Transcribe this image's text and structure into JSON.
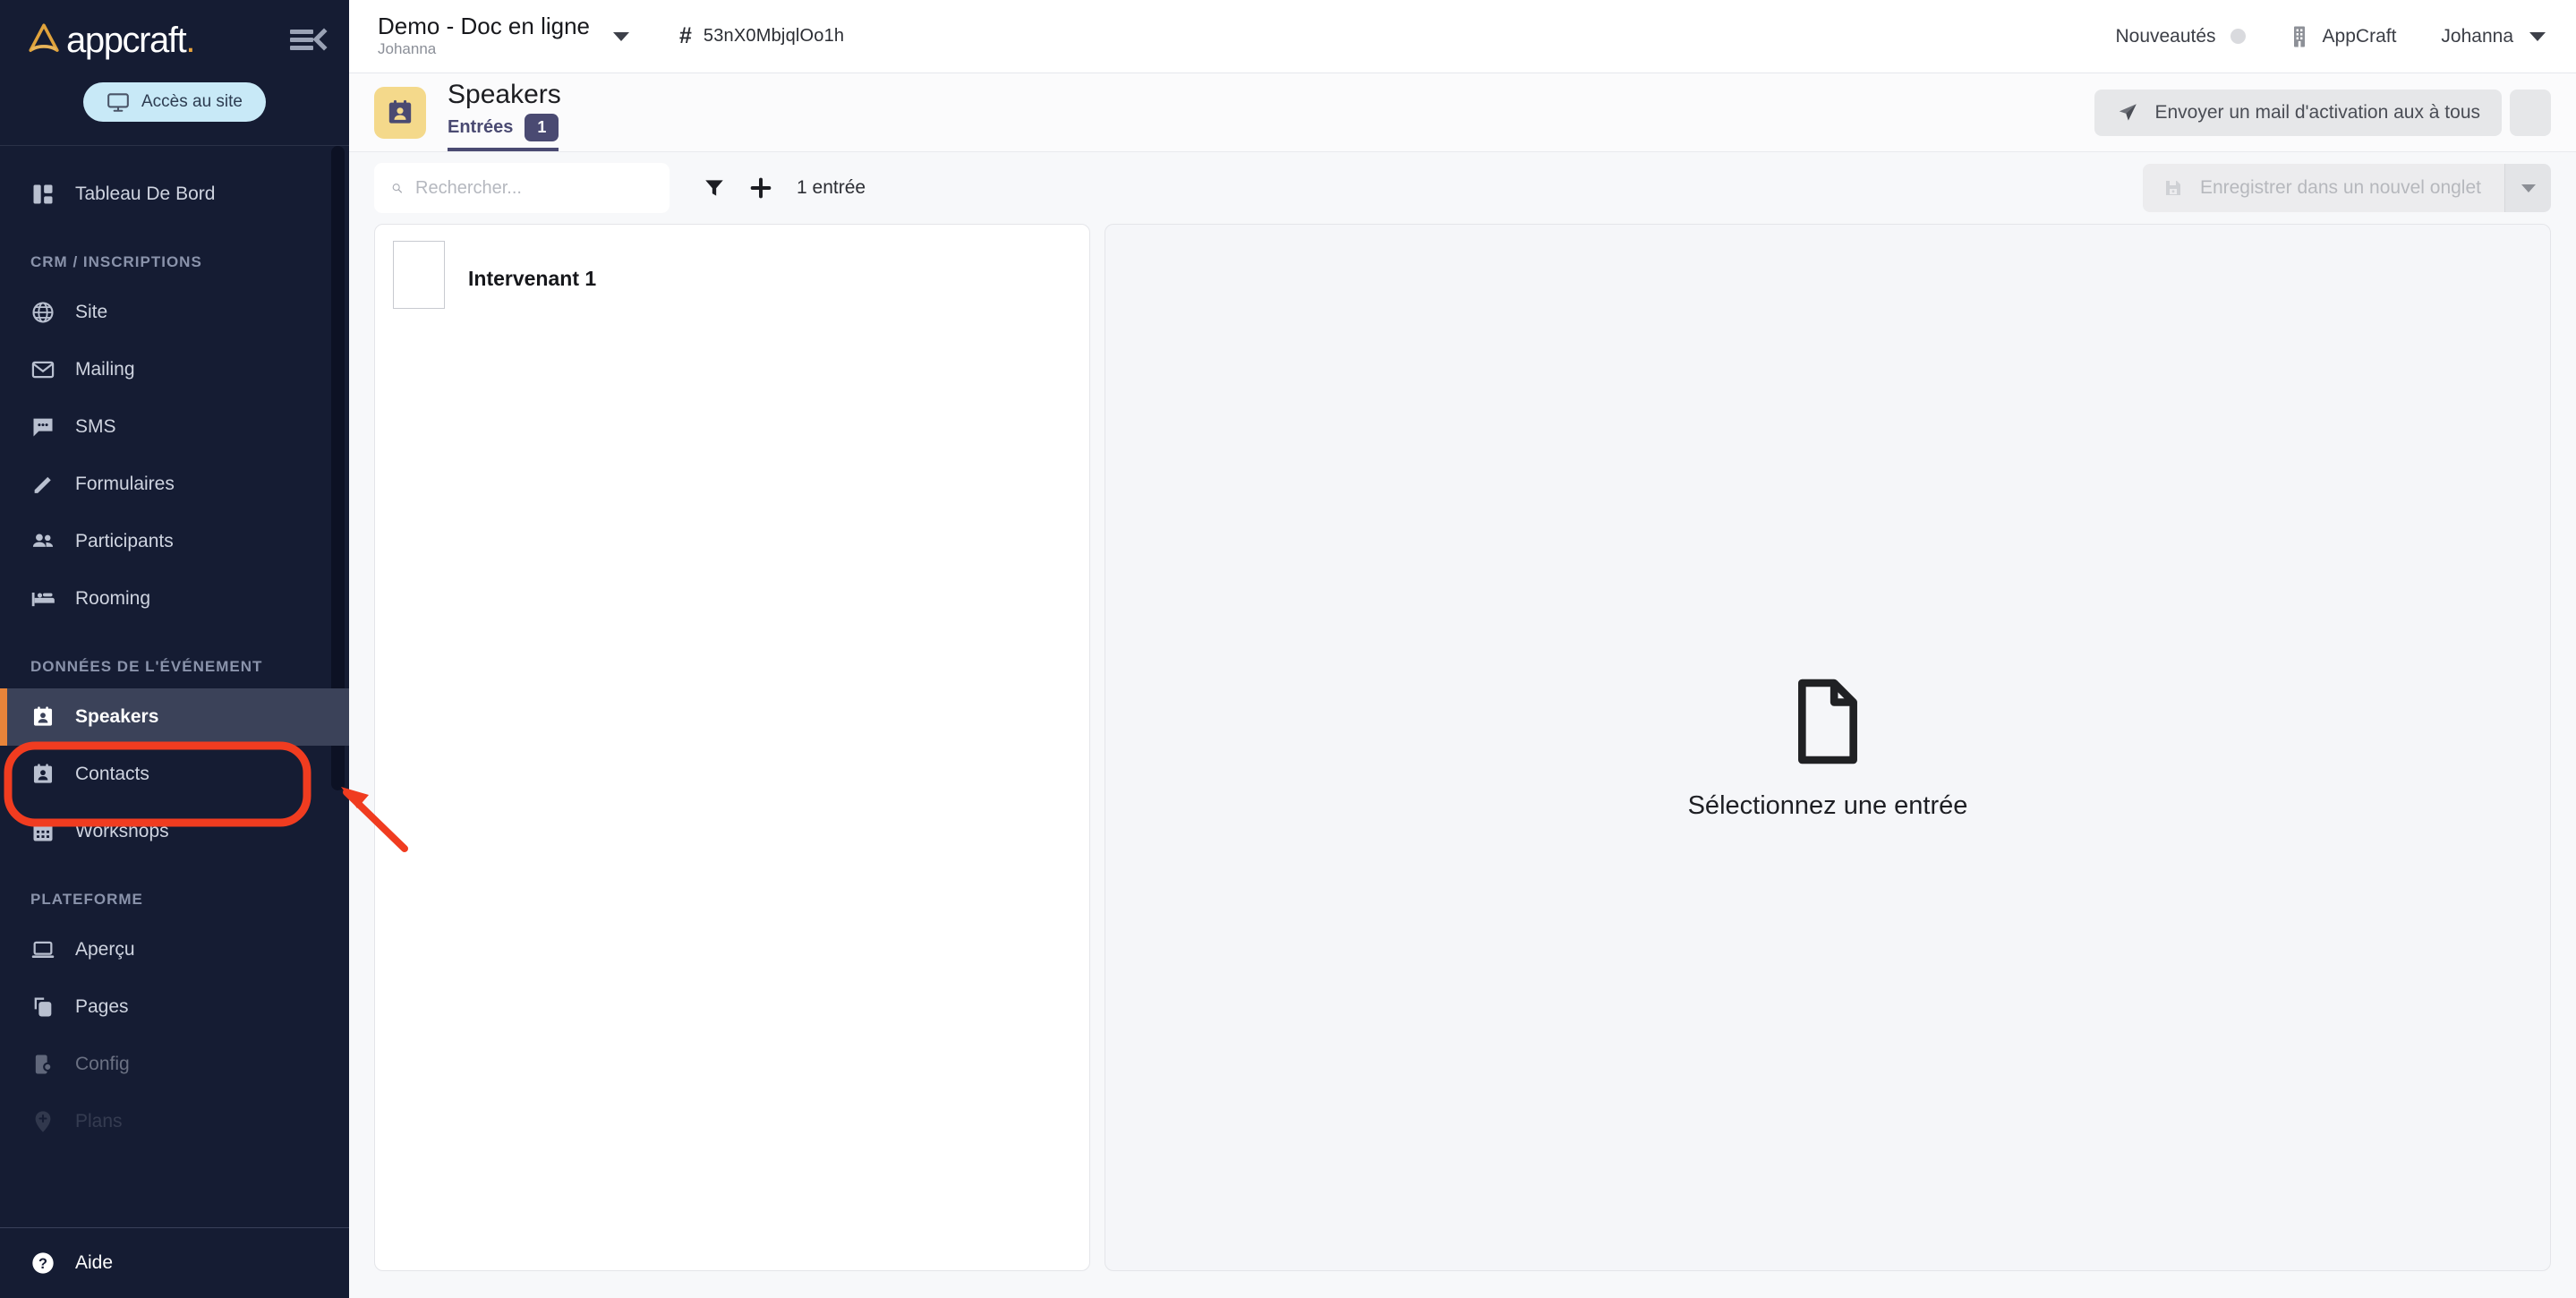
{
  "sidebar": {
    "brand": {
      "word": "appcraft",
      "dot": "."
    },
    "collapse_icon": "collapse-menu-icon",
    "access_button": {
      "label": "Accès au site",
      "icon": "monitor-icon"
    },
    "groups": [
      {
        "label": "",
        "items": [
          {
            "label": "Tableau De Bord",
            "icon": "dashboard-icon",
            "state": "normal"
          }
        ]
      },
      {
        "label": "CRM / INSCRIPTIONS",
        "items": [
          {
            "label": "Site",
            "icon": "globe-icon",
            "state": "normal"
          },
          {
            "label": "Mailing",
            "icon": "envelope-icon",
            "state": "normal"
          },
          {
            "label": "SMS",
            "icon": "chat-icon",
            "state": "normal"
          },
          {
            "label": "Formulaires",
            "icon": "pencil-icon",
            "state": "normal"
          },
          {
            "label": "Participants",
            "icon": "people-icon",
            "state": "normal"
          },
          {
            "label": "Rooming",
            "icon": "bed-icon",
            "state": "normal"
          }
        ]
      },
      {
        "label": "DONNÉES DE L'ÉVÉNEMENT",
        "items": [
          {
            "label": "Speakers",
            "icon": "contact-badge-icon",
            "state": "active"
          },
          {
            "label": "Contacts",
            "icon": "contact-badge-icon",
            "state": "normal"
          },
          {
            "label": "Workshops",
            "icon": "calendar-icon",
            "state": "normal"
          }
        ]
      },
      {
        "label": "PLATEFORME",
        "items": [
          {
            "label": "Aperçu",
            "icon": "laptop-icon",
            "state": "normal"
          },
          {
            "label": "Pages",
            "icon": "pages-icon",
            "state": "normal"
          },
          {
            "label": "Config",
            "icon": "device-gear-icon",
            "state": "faded"
          },
          {
            "label": "Plans",
            "icon": "map-pin-icon",
            "state": "faded2"
          }
        ]
      }
    ],
    "help": {
      "label": "Aide",
      "icon": "question-circle-icon"
    },
    "accent_color": "#e8843a",
    "background_color": "#151c33"
  },
  "topbar": {
    "project_name": "Demo - Doc en ligne",
    "project_owner": "Johanna",
    "project_caret": "chevron-down-icon",
    "hash_symbol": "#",
    "project_id": "53nX0MbjqlOo1h",
    "news_label": "Nouveautés",
    "org_label": "AppCraft",
    "org_icon": "building-icon",
    "user_label": "Johanna"
  },
  "page_header": {
    "icon": "contact-badge-icon",
    "icon_bg": "#f4d98b",
    "title": "Speakers",
    "tab_label": "Entrées",
    "tab_badge": "1",
    "tab_color": "#4a4a72",
    "send_button": {
      "label": "Envoyer un mail d'activation aux à tous",
      "icon": "send-icon"
    },
    "kebab": "more-vertical-icon"
  },
  "toolbar": {
    "search_placeholder": "Rechercher...",
    "search_value": "",
    "search_icon": "search-icon",
    "filter_icon": "filter-icon",
    "add_icon": "plus-icon",
    "count_label": "1 entrée",
    "save_label": "Enregistrer dans un nouvel onglet",
    "save_icon": "save-icon",
    "save_caret": "chevron-down-icon"
  },
  "content": {
    "entries": [
      {
        "name": "Intervenant 1",
        "thumb": "photo-placeholder"
      }
    ],
    "empty_state": {
      "icon": "document-icon",
      "label": "Sélectionnez une entrée"
    }
  },
  "annotation": {
    "highlight_color": "#f03c20",
    "target": "sidebar-item-speakers"
  }
}
